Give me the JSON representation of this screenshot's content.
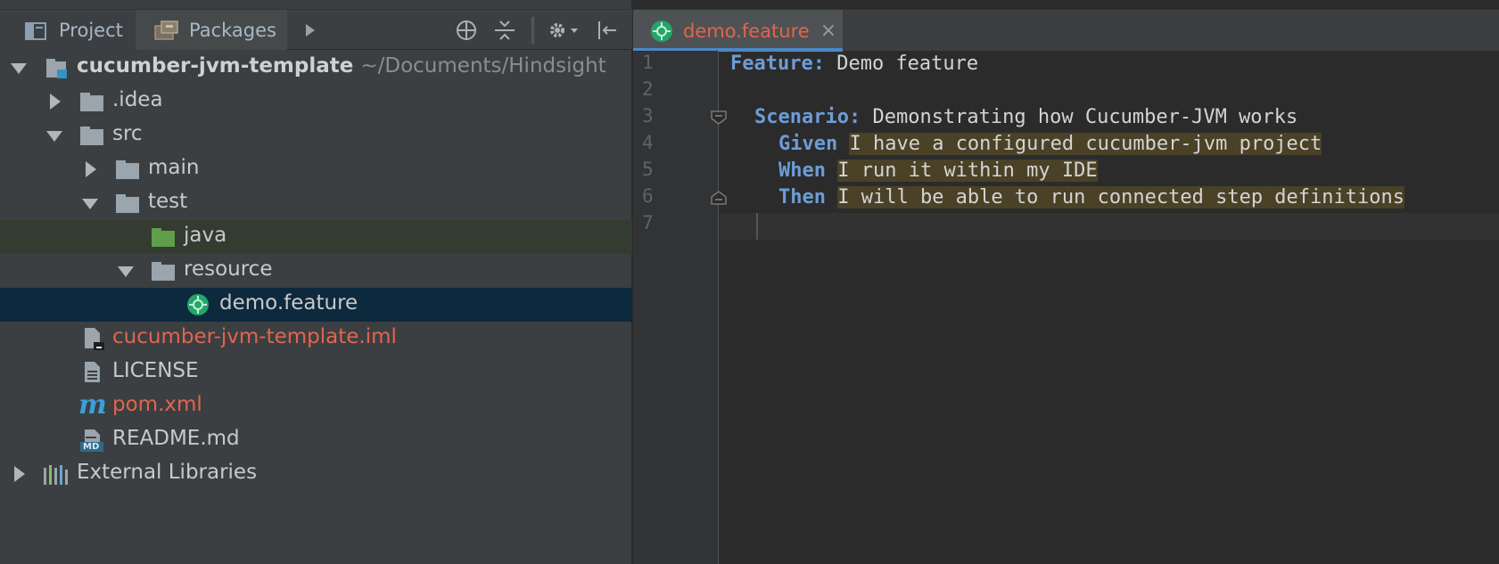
{
  "project_panel": {
    "tabs": [
      {
        "label": "Project",
        "icon": "project-icon",
        "active": true
      },
      {
        "label": "Packages",
        "icon": "packages-icon",
        "active": false
      }
    ],
    "toolbar_icons": [
      "play-arrow-icon",
      "locate-icon",
      "collapse-all-icon",
      "gear-icon",
      "hide-panel-icon"
    ]
  },
  "tree": {
    "root": {
      "label": "cucumber-jvm-template",
      "path": "~/Documents/Hindsight"
    },
    "idea": ".idea",
    "src": "src",
    "main": "main",
    "test": "test",
    "java": "java",
    "resource": "resource",
    "demo_feature": "demo.feature",
    "iml": "cucumber-jvm-template.iml",
    "license": "LICENSE",
    "pom": "pom.xml",
    "readme": "README.md",
    "md_badge": "MD",
    "external": "External Libraries",
    "pom_badge": "m"
  },
  "editor": {
    "tab_label": "demo.feature",
    "tab_close": "×",
    "line_numbers": [
      "1",
      "2",
      "3",
      "4",
      "5",
      "6",
      "7"
    ],
    "lines": {
      "l1_kw": "Feature:",
      "l1_text": " Demo feature",
      "l3_kw": "Scenario:",
      "l3_text": " Demonstrating how Cucumber-JVM works",
      "l4_kw": "Given",
      "l4_text": "I have a configured cucumber-jvm project",
      "l5_kw": "When",
      "l5_text": "I run it within my IDE",
      "l6_kw": "Then",
      "l6_text": "I will be able to run connected step definitions"
    }
  },
  "colors": {
    "panel_bg": "#3c3f41",
    "editor_bg": "#2b2b2b",
    "selection": "#0d293e",
    "keyword": "#6d9cd8",
    "modified_red": "#e2644e",
    "cucumber_green": "#23a56c",
    "step_highlight": "#4a4127"
  }
}
